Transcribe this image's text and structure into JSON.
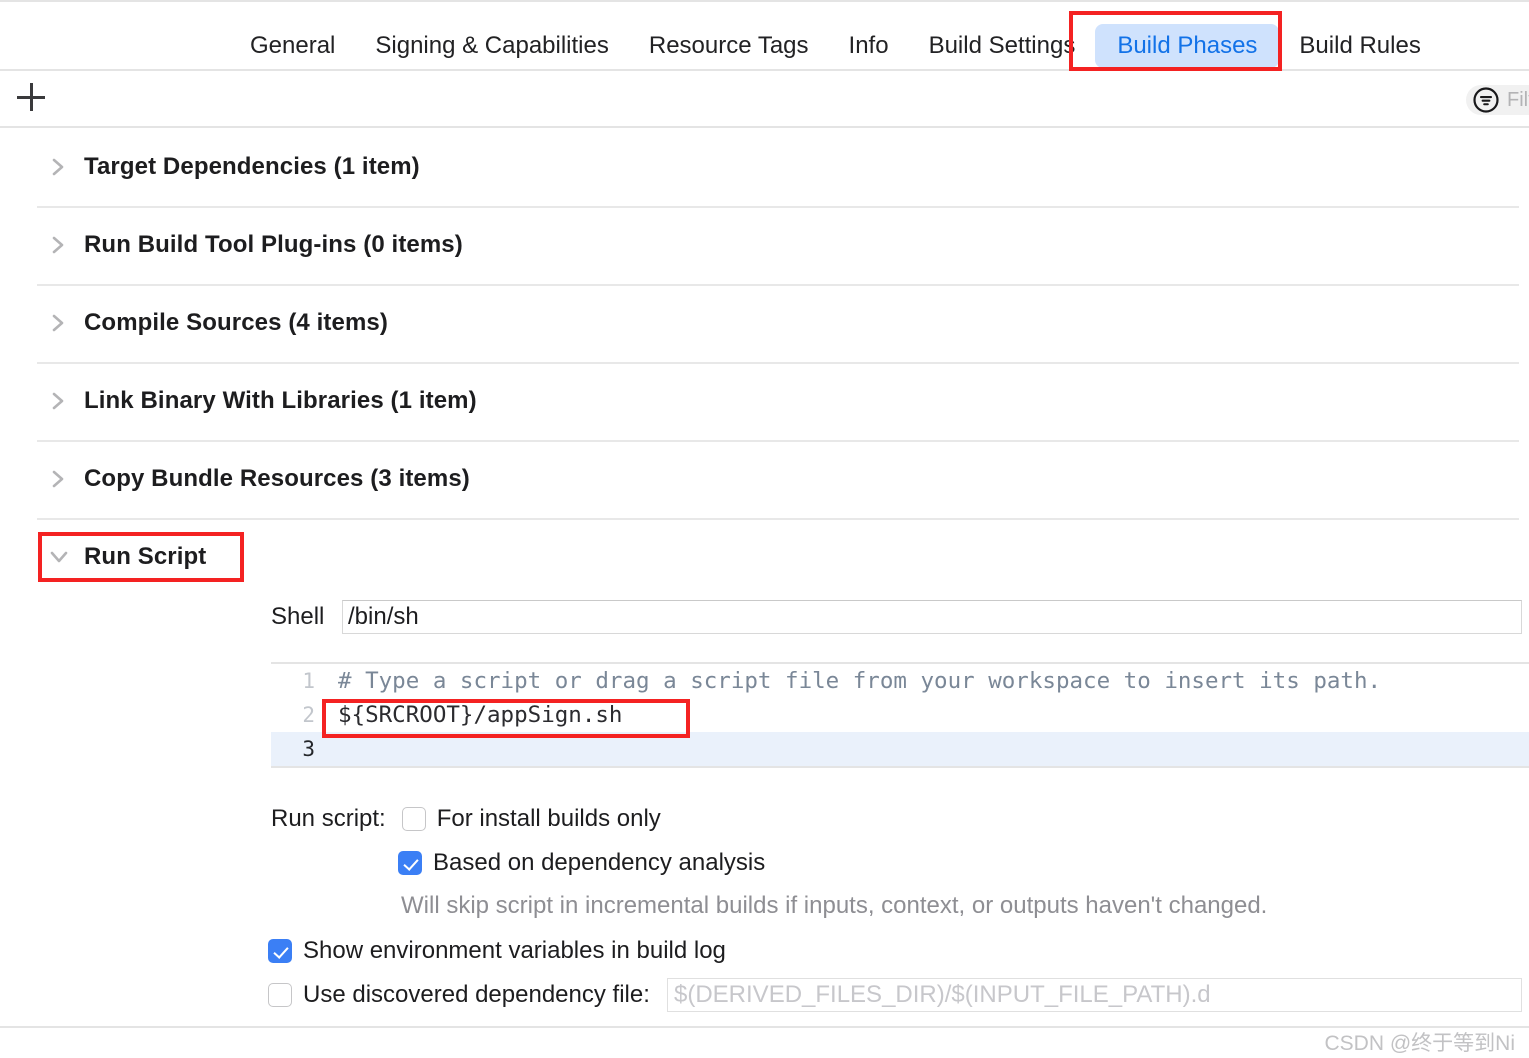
{
  "tabs": [
    {
      "label": "General",
      "active": false
    },
    {
      "label": "Signing & Capabilities",
      "active": false
    },
    {
      "label": "Resource Tags",
      "active": false
    },
    {
      "label": "Info",
      "active": false
    },
    {
      "label": "Build Settings",
      "active": false
    },
    {
      "label": "Build Phases",
      "active": true
    },
    {
      "label": "Build Rules",
      "active": false
    }
  ],
  "toolbar": {
    "add_label": "+",
    "filter_placeholder": "Filt"
  },
  "phases": [
    {
      "title": "Target Dependencies (1 item)",
      "expanded": false
    },
    {
      "title": "Run Build Tool Plug-ins (0 items)",
      "expanded": false
    },
    {
      "title": "Compile Sources (4 items)",
      "expanded": false
    },
    {
      "title": "Link Binary With Libraries (1 item)",
      "expanded": false
    },
    {
      "title": "Copy Bundle Resources (3 items)",
      "expanded": false
    },
    {
      "title": "Run Script",
      "expanded": true
    }
  ],
  "run_script": {
    "shell_label": "Shell",
    "shell_value": "/bin/sh",
    "code_lines": [
      {
        "number": "1",
        "text": "# Type a script or drag a script file from your workspace to insert its path.",
        "comment": true,
        "active": false
      },
      {
        "number": "2",
        "text": "${SRCROOT}/appSign.sh",
        "comment": false,
        "active": false
      },
      {
        "number": "3",
        "text": "",
        "comment": false,
        "active": true
      }
    ],
    "run_script_label": "Run script:",
    "install_builds_only": {
      "label": "For install builds only",
      "checked": false
    },
    "dependency_analysis": {
      "label": "Based on dependency analysis",
      "checked": true
    },
    "dependency_hint": "Will skip script in incremental builds if inputs, context, or outputs haven't changed.",
    "show_env_vars": {
      "label": "Show environment variables in build log",
      "checked": true
    },
    "use_dep_file": {
      "label": "Use discovered dependency file:",
      "checked": false
    },
    "dep_file_placeholder": "$(DERIVED_FILES_DIR)/$(INPUT_FILE_PATH).d"
  },
  "annotations": {
    "color": "#f42222",
    "targets": [
      "build-phases-tab",
      "run-script-phase",
      "script-line-2"
    ]
  },
  "watermark": "CSDN @终于等到Ni",
  "colors": {
    "accent": "#1272e8",
    "active_tab_bg": "#cfe2fd",
    "checkbox_on": "#3b7ff5",
    "annotation_red": "#f42222",
    "active_line_bg": "#eaf1fb"
  }
}
